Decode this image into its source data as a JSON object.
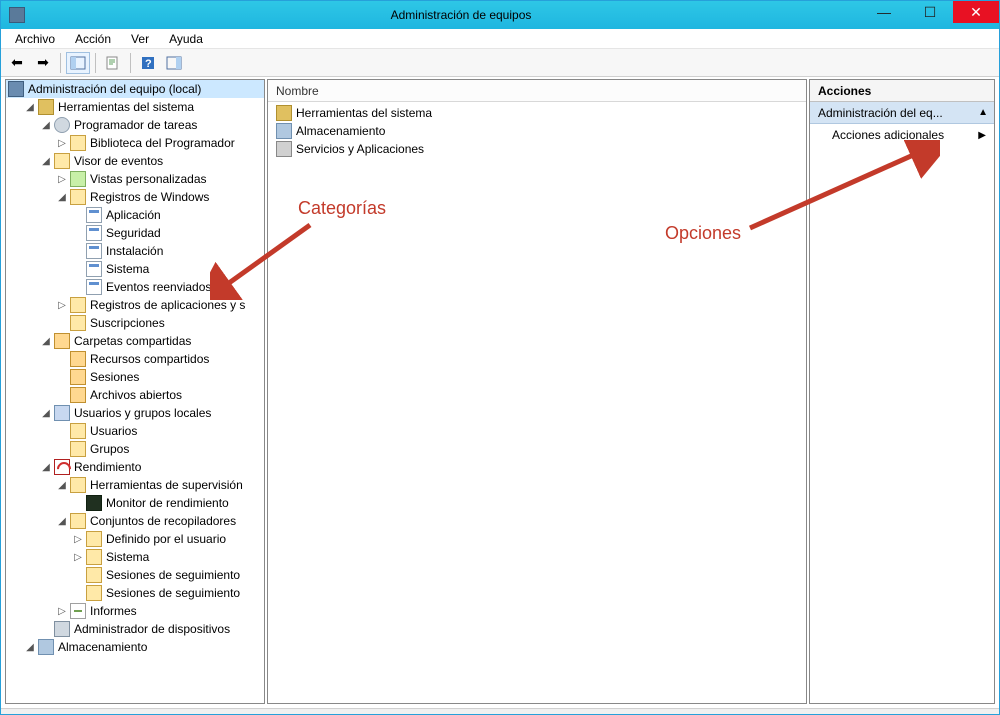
{
  "window": {
    "title": "Administración de equipos"
  },
  "menu": {
    "file": "Archivo",
    "action": "Acción",
    "view": "Ver",
    "help": "Ayuda"
  },
  "tree": {
    "root": "Administración del equipo (local)",
    "system_tools": "Herramientas del sistema",
    "task_scheduler": "Programador de tareas",
    "scheduler_library": "Biblioteca del Programador",
    "event_viewer": "Visor de eventos",
    "custom_views": "Vistas personalizadas",
    "windows_logs": "Registros de Windows",
    "log_application": "Aplicación",
    "log_security": "Seguridad",
    "log_setup": "Instalación",
    "log_system": "Sistema",
    "log_forwarded": "Eventos reenviados",
    "app_services_logs": "Registros de aplicaciones y s",
    "subscriptions": "Suscripciones",
    "shared_folders": "Carpetas compartidas",
    "shares": "Recursos compartidos",
    "sessions": "Sesiones",
    "open_files": "Archivos abiertos",
    "local_users": "Usuarios y grupos locales",
    "users": "Usuarios",
    "groups": "Grupos",
    "performance": "Rendimiento",
    "monitoring_tools": "Herramientas de supervisión",
    "perf_monitor": "Monitor de rendimiento",
    "collector_sets": "Conjuntos de recopiladores",
    "user_defined": "Definido por el usuario",
    "cs_system": "Sistema",
    "trace_sessions1": "Sesiones de seguimiento",
    "trace_sessions2": "Sesiones de seguimiento",
    "reports": "Informes",
    "device_manager": "Administrador de dispositivos",
    "storage": "Almacenamiento"
  },
  "list": {
    "header_name": "Nombre",
    "items": [
      "Herramientas del sistema",
      "Almacenamiento",
      "Servicios y Aplicaciones"
    ]
  },
  "actions": {
    "header": "Acciones",
    "context": "Administración del eq...",
    "additional": "Acciones adicionales"
  },
  "annotations": {
    "categories": "Categorías",
    "options": "Opciones"
  }
}
